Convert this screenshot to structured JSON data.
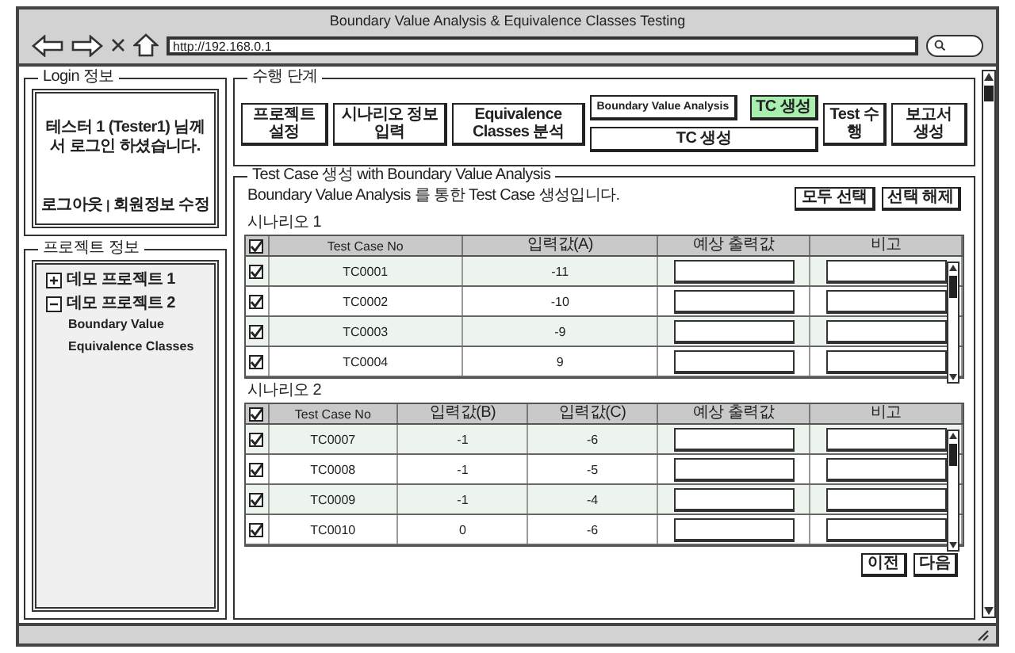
{
  "window": {
    "title": "Boundary Value Analysis & Equivalence Classes Testing"
  },
  "browser": {
    "address": "http://192.168.0.1"
  },
  "login": {
    "title": "Login 정보",
    "message": "테스터 1 (Tester1) 님께서 로그인 하셨습니다.",
    "links": [
      "로그아웃",
      "회원정보 수정"
    ],
    "separator": "|"
  },
  "projects": {
    "title": "프로젝트 정보",
    "items": [
      {
        "label": "데모 프로젝트 1",
        "expanded": false
      },
      {
        "label": "데모 프로젝트 2",
        "expanded": true,
        "children": [
          {
            "label": "Boundary Value"
          },
          {
            "label": "Equivalence Classes"
          }
        ]
      }
    ]
  },
  "steps": {
    "title": "수행 단계",
    "items": [
      {
        "kind": "step",
        "label": "프로젝트 설정",
        "selected": false
      },
      {
        "kind": "step",
        "label": "시나리오 정보 입력",
        "selected": false
      },
      {
        "kind": "step",
        "label": "Equivalence Classes 분석",
        "selected": false
      },
      {
        "kind": "branch",
        "top": [
          {
            "label": "Boundary Value Analysis",
            "selected": false
          },
          {
            "label": "TC 생성",
            "selected": true
          }
        ],
        "bottom": [
          {
            "label": "TC 생성",
            "selected": false
          }
        ]
      },
      {
        "kind": "step",
        "label": "Test 수행",
        "selected": false
      },
      {
        "kind": "step",
        "label": "보고서 생성",
        "selected": false
      }
    ]
  },
  "testcase": {
    "title": "Test Case 생성 with Boundary Value Analysis",
    "description": "Boundary Value Analysis 를 통한 Test Case 생성입니다.",
    "actions": [
      "모두 선택",
      "선택 해제"
    ],
    "scenarios": [
      {
        "title": "시나리오 1",
        "all_checked": true,
        "columns": [
          {
            "label": "Test Case No",
            "kind": "text"
          },
          {
            "label": "입력값(A)",
            "kind": "text"
          },
          {
            "label": "예상 출력값",
            "kind": "input"
          },
          {
            "label": "비고",
            "kind": "input"
          }
        ],
        "rows": [
          {
            "checked": true,
            "cells": [
              "TC0001",
              "-11"
            ]
          },
          {
            "checked": true,
            "cells": [
              "TC0002",
              "-10"
            ]
          },
          {
            "checked": true,
            "cells": [
              "TC0003",
              "-9"
            ]
          },
          {
            "checked": true,
            "cells": [
              "TC0004",
              "9"
            ]
          }
        ]
      },
      {
        "title": "시나리오 2",
        "all_checked": true,
        "columns": [
          {
            "label": "Test Case No",
            "kind": "text"
          },
          {
            "label": "입력값(B)",
            "kind": "text"
          },
          {
            "label": "입력값(C)",
            "kind": "text"
          },
          {
            "label": "예상 출력값",
            "kind": "input"
          },
          {
            "label": "비고",
            "kind": "input"
          }
        ],
        "rows": [
          {
            "checked": true,
            "cells": [
              "TC0007",
              "-1",
              "-6"
            ]
          },
          {
            "checked": true,
            "cells": [
              "TC0008",
              "-1",
              "-5"
            ]
          },
          {
            "checked": true,
            "cells": [
              "TC0009",
              "-1",
              "-4"
            ]
          },
          {
            "checked": true,
            "cells": [
              "TC0010",
              "0",
              "-6"
            ]
          }
        ]
      }
    ],
    "navigation": [
      "이전",
      "다음"
    ]
  }
}
